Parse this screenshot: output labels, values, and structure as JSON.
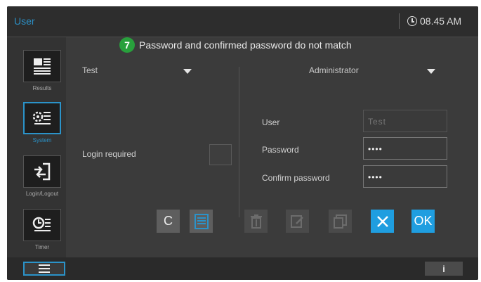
{
  "window": {
    "title": "User",
    "time": "08.45 AM"
  },
  "sidebar": {
    "items": [
      {
        "label": "Results",
        "icon": "results-icon",
        "active": false
      },
      {
        "label": "System",
        "icon": "system-icon",
        "active": true
      },
      {
        "label": "Login/Logout",
        "icon": "login-logout-icon",
        "active": false
      },
      {
        "label": "Timer",
        "icon": "timer-icon",
        "active": false
      }
    ]
  },
  "message": {
    "number": "7",
    "text": "Password and confirmed password do not match"
  },
  "left_panel": {
    "user_select": "Test",
    "login_required_label": "Login required"
  },
  "right_panel": {
    "role_select": "Administrator",
    "user_label": "User",
    "user_value": "Test",
    "password_label": "Password",
    "password_value": "••••",
    "confirm_label": "Confirm password",
    "confirm_value": "••••"
  },
  "buttons": {
    "clear": "C",
    "ok": "OK"
  },
  "colors": {
    "accent": "#1f9ee0",
    "badge": "#28a03c",
    "background": "#3b3b3b"
  }
}
